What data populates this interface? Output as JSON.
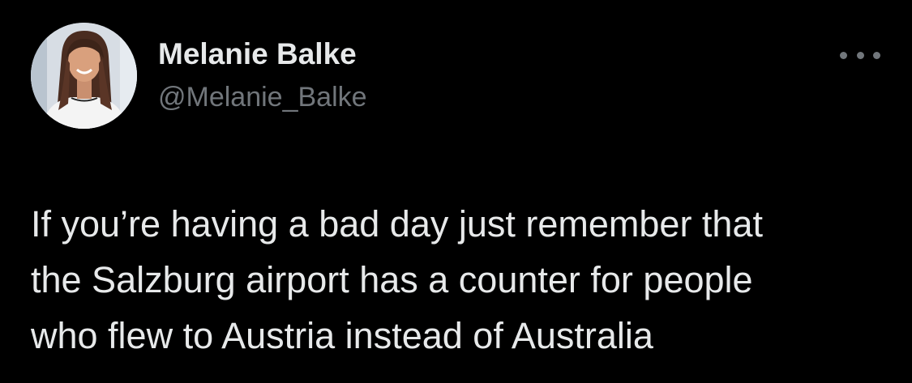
{
  "author": {
    "display_name": "Melanie Balke",
    "handle": "@Melanie_Balke",
    "avatar_icon": "profile-photo"
  },
  "more_menu": {
    "icon": "more-horizontal-icon"
  },
  "tweet": {
    "lines": [
      "If you’re having a bad day just remember that",
      "the Salzburg airport has a counter for people",
      "who flew to Austria instead of Australia"
    ]
  },
  "colors": {
    "background": "#000000",
    "primary_text": "#e7e9ea",
    "secondary_text": "#71767b"
  }
}
